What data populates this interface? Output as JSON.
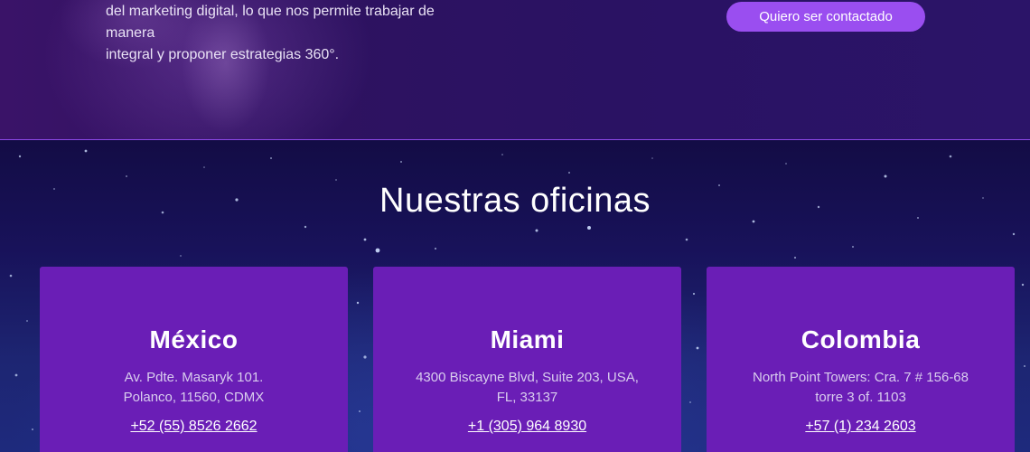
{
  "hero": {
    "text_lines": [
      "del marketing digital, lo que nos permite trabajar de",
      "manera",
      "integral y proponer estrategias 360°."
    ],
    "contact_button_label": "Quiero ser contactado"
  },
  "offices": {
    "title": "Nuestras oficinas",
    "cards": [
      {
        "city": "México",
        "address_lines": [
          "Av. Pdte. Masaryk 101.",
          "Polanco, 11560, CDMX"
        ],
        "phone": "+52 (55) 8526 2662"
      },
      {
        "city": "Miami",
        "address_lines": [
          "4300 Biscayne Blvd, Suite 203, USA,",
          "FL, 33137"
        ],
        "phone": "+1 (305) 964 8930"
      },
      {
        "city": "Colombia",
        "address_lines": [
          "North Point Towers: Cra. 7 # 156-68",
          "torre 3 of. 1103"
        ],
        "phone": "+57 (1) 234 2603"
      }
    ]
  },
  "colors": {
    "card_background": "#6a1eb6",
    "button_background": "#9a4ef0",
    "divider": "#8b48e6"
  }
}
